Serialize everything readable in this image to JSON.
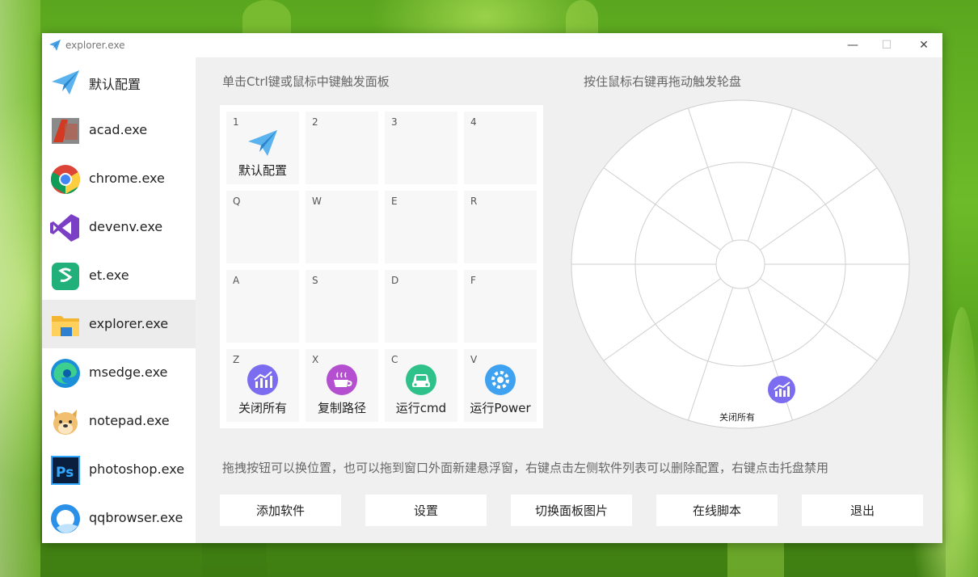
{
  "window": {
    "title": "explorer.exe",
    "minimize_glyph": "—",
    "maximize_glyph": "☐",
    "close_glyph": "✕"
  },
  "sidebar": {
    "selected_index": 5,
    "items": [
      {
        "label": "默认配置",
        "icon": "paper-plane-icon"
      },
      {
        "label": "acad.exe",
        "icon": "autocad-icon"
      },
      {
        "label": "chrome.exe",
        "icon": "chrome-icon"
      },
      {
        "label": "devenv.exe",
        "icon": "visual-studio-icon"
      },
      {
        "label": "et.exe",
        "icon": "wps-spreadsheet-icon"
      },
      {
        "label": "explorer.exe",
        "icon": "folder-icon"
      },
      {
        "label": "msedge.exe",
        "icon": "edge-icon"
      },
      {
        "label": "notepad.exe",
        "icon": "doge-icon"
      },
      {
        "label": "photoshop.exe",
        "icon": "photoshop-icon"
      },
      {
        "label": "qqbrowser.exe",
        "icon": "qqbrowser-icon"
      }
    ]
  },
  "panel": {
    "hint": "单击Ctrl键或鼠标中键触发面板",
    "cells": [
      {
        "key": "1",
        "label": "默认配置",
        "icon": "paper-plane-icon"
      },
      {
        "key": "2",
        "label": "",
        "icon": ""
      },
      {
        "key": "3",
        "label": "",
        "icon": ""
      },
      {
        "key": "4",
        "label": "",
        "icon": ""
      },
      {
        "key": "Q",
        "label": "",
        "icon": ""
      },
      {
        "key": "W",
        "label": "",
        "icon": ""
      },
      {
        "key": "E",
        "label": "",
        "icon": ""
      },
      {
        "key": "R",
        "label": "",
        "icon": ""
      },
      {
        "key": "A",
        "label": "",
        "icon": ""
      },
      {
        "key": "S",
        "label": "",
        "icon": ""
      },
      {
        "key": "D",
        "label": "",
        "icon": ""
      },
      {
        "key": "F",
        "label": "",
        "icon": ""
      },
      {
        "key": "Z",
        "label": "关闭所有",
        "icon": "chart-purple-icon"
      },
      {
        "key": "X",
        "label": "复制路径",
        "icon": "coffee-icon"
      },
      {
        "key": "C",
        "label": "运行cmd",
        "icon": "car-icon"
      },
      {
        "key": "V",
        "label": "运行Power",
        "icon": "gear-blue-icon"
      }
    ]
  },
  "wheel": {
    "hint": "按住鼠标右键再拖动触发轮盘",
    "item_label": "关闭所有",
    "item_icon": "chart-purple-icon"
  },
  "footer": {
    "hint": "拖拽按钮可以换位置，也可以拖到窗口外面新建悬浮窗，右键点击左侧软件列表可以删除配置，右键点击托盘禁用",
    "buttons": [
      "添加软件",
      "设置",
      "切换面板图片",
      "在线脚本",
      "退出"
    ]
  },
  "colors": {
    "window_bg": "#f0f0f0",
    "selected_row": "#ececec",
    "accent_blue": "#3a9ad9",
    "purple": "#7b6cf0"
  }
}
